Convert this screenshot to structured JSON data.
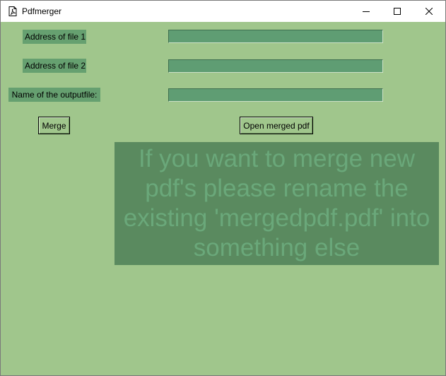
{
  "window": {
    "title": "Pdfmerger",
    "app_icon": "pdf-file-icon",
    "controls": {
      "minimize_icon": "minimize-icon",
      "maximize_icon": "maximize-icon",
      "close_icon": "close-icon"
    }
  },
  "colors": {
    "background": "#a0c68c",
    "label_background": "#66a070",
    "entry_background": "#5f9d73",
    "notice_background": "#5a8a5f",
    "notice_text": "#6aa87a"
  },
  "form": {
    "file1_label": "Address of file 1",
    "file1_value": "",
    "file2_label": "Address of file 2",
    "file2_value": "",
    "output_label": "Name of the outputfile:",
    "output_value": ""
  },
  "buttons": {
    "merge_label": "Merge",
    "open_label": "Open merged pdf"
  },
  "notice": {
    "lines": [
      "If you want to merge new",
      "pdf's please rename the",
      "existing 'mergedpdf.pdf' into",
      "something else"
    ]
  }
}
